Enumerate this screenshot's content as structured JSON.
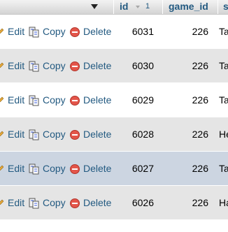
{
  "header": {
    "id_label": "id",
    "id_sort_order": "1",
    "game_id_label": "game_id",
    "next_col_label_partial": "s"
  },
  "actions": {
    "edit_label": "Edit",
    "copy_label": "Copy",
    "delete_label": "Delete"
  },
  "rows": [
    {
      "id": "6031",
      "game_id": "226",
      "next_partial": "Ta",
      "highlighted": false
    },
    {
      "id": "6030",
      "game_id": "226",
      "next_partial": "Ta",
      "highlighted": false
    },
    {
      "id": "6029",
      "game_id": "226",
      "next_partial": "Ta",
      "highlighted": false
    },
    {
      "id": "6028",
      "game_id": "226",
      "next_partial": "He",
      "highlighted": false
    },
    {
      "id": "6027",
      "game_id": "226",
      "next_partial": "Ta",
      "highlighted": true
    },
    {
      "id": "6026",
      "game_id": "226",
      "next_partial": "Ha",
      "highlighted": false
    }
  ],
  "colors": {
    "link": "#235a81",
    "row_odd": "#e5e5e5",
    "row_hover": "#ccd5e1",
    "delete_icon": "#e3554a"
  }
}
